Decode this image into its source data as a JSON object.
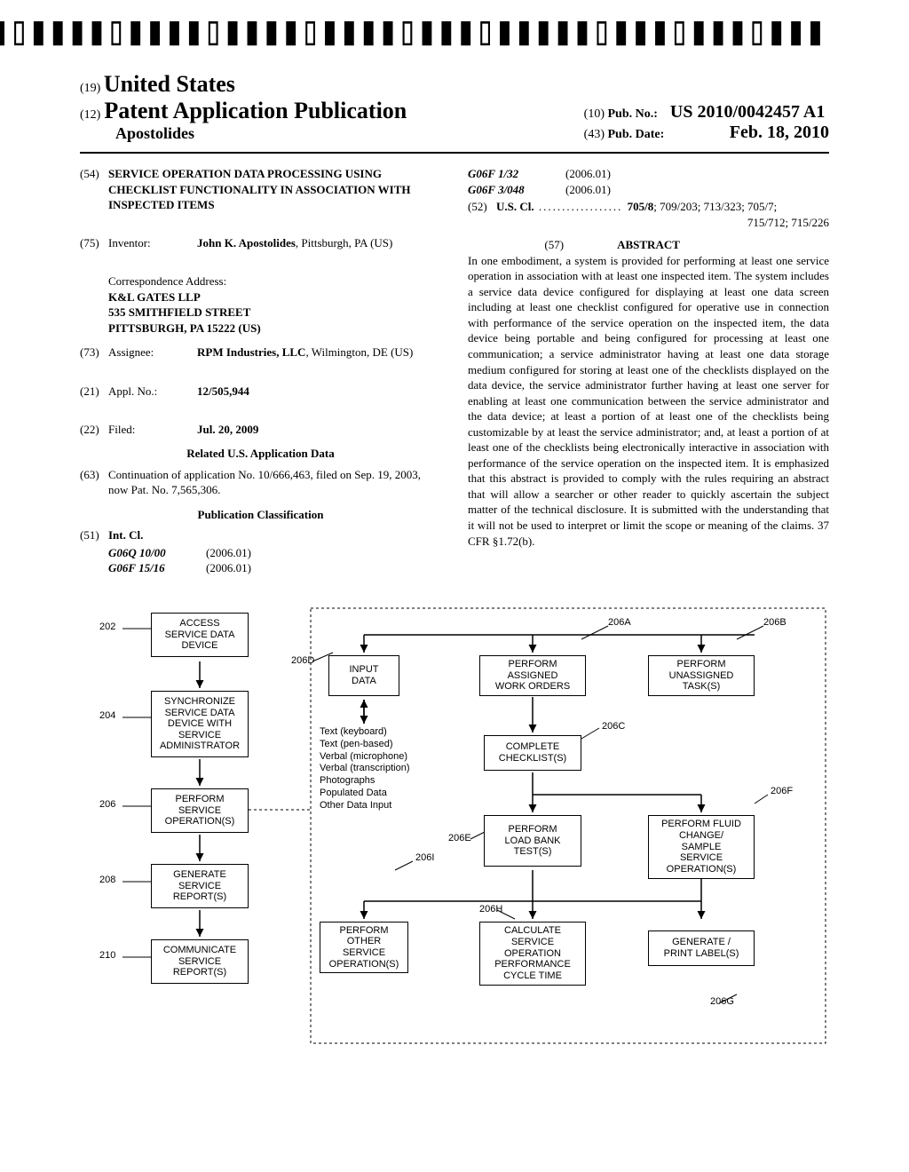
{
  "barcode": {
    "text": "US 20100042457A1"
  },
  "header": {
    "country_code": "(19)",
    "country": "United States",
    "pub_type_code": "(12)",
    "pub_type": "Patent Application Publication",
    "author": "Apostolides",
    "pub_no_code": "(10)",
    "pub_no_label": "Pub. No.:",
    "pub_no": "US 2010/0042457 A1",
    "pub_date_code": "(43)",
    "pub_date_label": "Pub. Date:",
    "pub_date": "Feb. 18, 2010"
  },
  "left_col": {
    "title_code": "(54)",
    "title": "SERVICE OPERATION DATA PROCESSING USING CHECKLIST FUNCTIONALITY IN ASSOCIATION WITH INSPECTED ITEMS",
    "inventor_code": "(75)",
    "inventor_label": "Inventor:",
    "inventor_name": "John K. Apostolides",
    "inventor_loc": ", Pittsburgh, PA (US)",
    "correspondence_label": "Correspondence Address:",
    "correspondence_line1": "K&L GATES LLP",
    "correspondence_line2": "535 SMITHFIELD STREET",
    "correspondence_line3": "PITTSBURGH, PA 15222 (US)",
    "assignee_code": "(73)",
    "assignee_label": "Assignee:",
    "assignee_name": "RPM Industries, LLC",
    "assignee_loc": ", Wilmington, DE (US)",
    "appl_code": "(21)",
    "appl_label": "Appl. No.:",
    "appl_no": "12/505,944",
    "filed_code": "(22)",
    "filed_label": "Filed:",
    "filed_date": "Jul. 20, 2009",
    "related_heading": "Related U.S. Application Data",
    "continuation_code": "(63)",
    "continuation_text": "Continuation of application No. 10/666,463, filed on Sep. 19, 2003, now Pat. No. 7,565,306.",
    "classification_heading": "Publication Classification",
    "intcl_code": "(51)",
    "intcl_label": "Int. Cl.",
    "intcl": [
      {
        "code": "G06Q 10/00",
        "ver": "(2006.01)"
      },
      {
        "code": "G06F 15/16",
        "ver": "(2006.01)"
      }
    ]
  },
  "right_col": {
    "intcl_more": [
      {
        "code": "G06F 1/32",
        "ver": "(2006.01)"
      },
      {
        "code": "G06F 3/048",
        "ver": "(2006.01)"
      }
    ],
    "uscl_code": "(52)",
    "uscl_label": "U.S. Cl.",
    "uscl_dots": " .................. ",
    "uscl_main": "705/8",
    "uscl_rest": "; 709/203; 713/323; 705/7;",
    "uscl_extra": "715/712; 715/226",
    "abstract_code": "(57)",
    "abstract_heading": "ABSTRACT",
    "abstract_text": "In one embodiment, a system is provided for performing at least one service operation in association with at least one inspected item. The system includes a service data device configured for displaying at least one data screen including at least one checklist configured for operative use in connection with performance of the service operation on the inspected item, the data device being portable and being configured for processing at least one communication; a service administrator having at least one data storage medium configured for storing at least one of the checklists displayed on the data device, the service administrator further having at least one server for enabling at least one communication between the service administrator and the data device; at least a portion of at least one of the checklists being customizable by at least the service administrator; and, at least a portion of at least one of the checklists being electronically interactive in association with performance of the service operation on the inspected item. It is emphasized that this abstract is provided to comply with the rules requiring an abstract that will allow a searcher or other reader to quickly ascertain the subject matter of the technical disclosure. It is submitted with the understanding that it will not be used to interpret or limit the scope or meaning of the claims. 37 CFR §1.72(b)."
  },
  "diagram": {
    "labels": {
      "l202": "202",
      "l204": "204",
      "l206": "206",
      "l208": "208",
      "l210": "210",
      "l206A": "206A",
      "l206B": "206B",
      "l206C": "206C",
      "l206D": "206D",
      "l206E": "206E",
      "l206F": "206F",
      "l206G": "206G",
      "l206H": "206H",
      "l206I": "206I"
    },
    "boxes": {
      "b202": "ACCESS\nSERVICE DATA\nDEVICE",
      "b204": "SYNCHRONIZE\nSERVICE DATA\nDEVICE WITH\nSERVICE\nADMINISTRATOR",
      "b206": "PERFORM\nSERVICE\nOPERATION(S)",
      "b208": "GENERATE\nSERVICE\nREPORT(S)",
      "b210": "COMMUNICATE\nSERVICE\nREPORT(S)",
      "b206D": "INPUT\nDATA",
      "b206A": "PERFORM\nASSIGNED\nWORK ORDERS",
      "b206B": "PERFORM\nUNASSIGNED\nTASK(S)",
      "b206C": "COMPLETE\nCHECKLIST(S)",
      "b206E": "PERFORM\nLOAD BANK\nTEST(S)",
      "b206F": "PERFORM FLUID\nCHANGE/\nSAMPLE\nSERVICE\nOPERATION(S)",
      "b206I": "PERFORM\nOTHER\nSERVICE\nOPERATION(S)",
      "b206H": "CALCULATE\nSERVICE\nOPERATION\nPERFORMANCE\nCYCLE TIME",
      "b206G": "GENERATE /\nPRINT LABEL(S)"
    },
    "textlist": "Text (keyboard)\nText (pen-based)\nVerbal (microphone)\nVerbal (transcription)\nPhotographs\nPopulated Data\nOther Data Input"
  }
}
